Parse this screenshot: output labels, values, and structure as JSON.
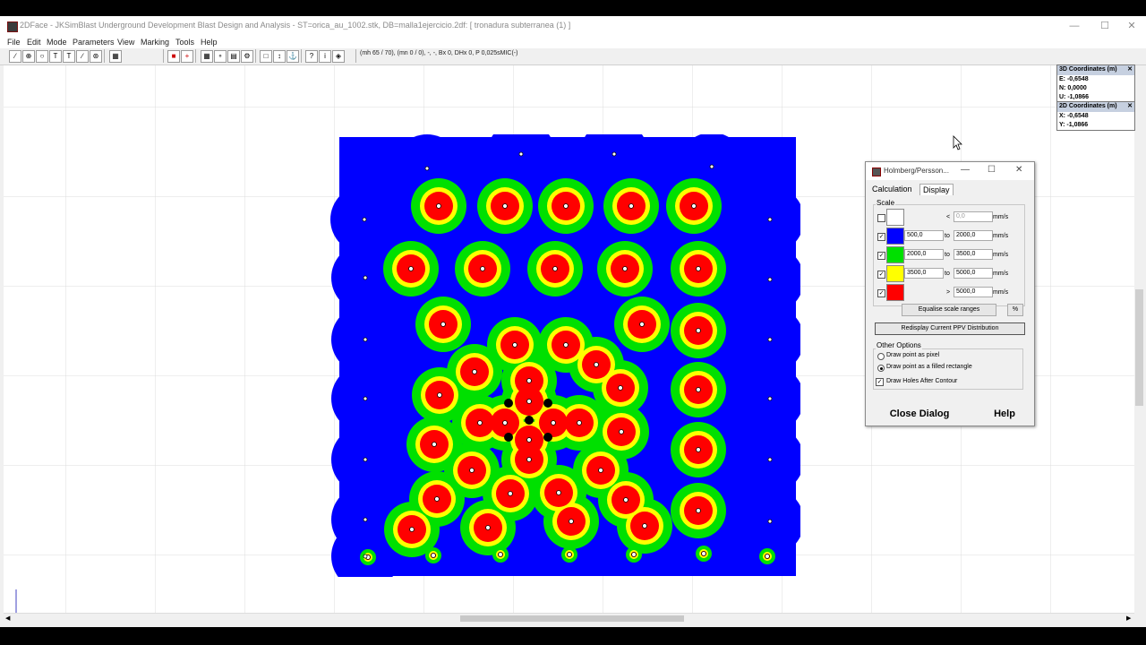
{
  "window": {
    "title": "2DFace - JKSimBlast Underground Development Blast Design and Analysis - ST=orica_au_1002.stk, DB=malla1ejercicio.2df: [ tronadura subterranea (1) ]",
    "min_label": "—",
    "max_label": "☐",
    "close_label": "✕"
  },
  "menu": [
    "File",
    "Edit",
    "Mode",
    "Parameters",
    "View",
    "Marking",
    "Tools",
    "Help"
  ],
  "toolbar": {
    "status": "(mh 65 / 70), (mn 0 / 0), -, -, Bx 0, DHx 0, P 0,025sMIC(-)"
  },
  "coords3d": {
    "title": "3D Coordinates (m)",
    "close": "✕",
    "e": "E: -0,6548",
    "n": "N: 0,0000",
    "u": "U: -1,0866"
  },
  "coords2d": {
    "title": "2D Coordinates (m)",
    "close": "✕",
    "x": "X: -0,6548",
    "y": "Y: -1,0866"
  },
  "dialog": {
    "title": "Holmberg/Persson...",
    "tabs": [
      "Calculation",
      "Display"
    ],
    "active_tab": "Display",
    "scale_label": "Scale",
    "unit": "mm/s",
    "to_label": "to",
    "rows": [
      {
        "checked": false,
        "checkmark": "",
        "color": "#ffffff",
        "op": "<",
        "from": "",
        "to": "0,0"
      },
      {
        "checked": true,
        "checkmark": "✓",
        "color": "#0000ff",
        "op": "to",
        "from": "500,0",
        "to": "2000,0"
      },
      {
        "checked": true,
        "checkmark": "✓",
        "color": "#00e000",
        "op": "to",
        "from": "2000,0",
        "to": "3500,0"
      },
      {
        "checked": true,
        "checkmark": "✓",
        "color": "#ffff00",
        "op": "to",
        "from": "3500,0",
        "to": "5000,0"
      },
      {
        "checked": true,
        "checkmark": "✓",
        "color": "#ff0000",
        "op": ">",
        "from": "",
        "to": "5000,0"
      }
    ],
    "equalise_label": "Equalise scale ranges",
    "percent_label": "%",
    "redisplay_label": "Redisplay Current PPV Distribution",
    "other_options_label": "Other Options",
    "options": [
      {
        "label": "Draw point as pixel",
        "selected": false
      },
      {
        "label": "Draw point as a filled rectangle",
        "selected": true
      }
    ],
    "draw_holes_label": "Draw Holes After Contour",
    "draw_holes_mark": "✓",
    "close_label": "Close Dialog",
    "help_label": "Help"
  },
  "colors": {
    "blue": "#0000ff",
    "green": "#00e000",
    "yellow": "#ffff00",
    "red": "#ff0000"
  }
}
